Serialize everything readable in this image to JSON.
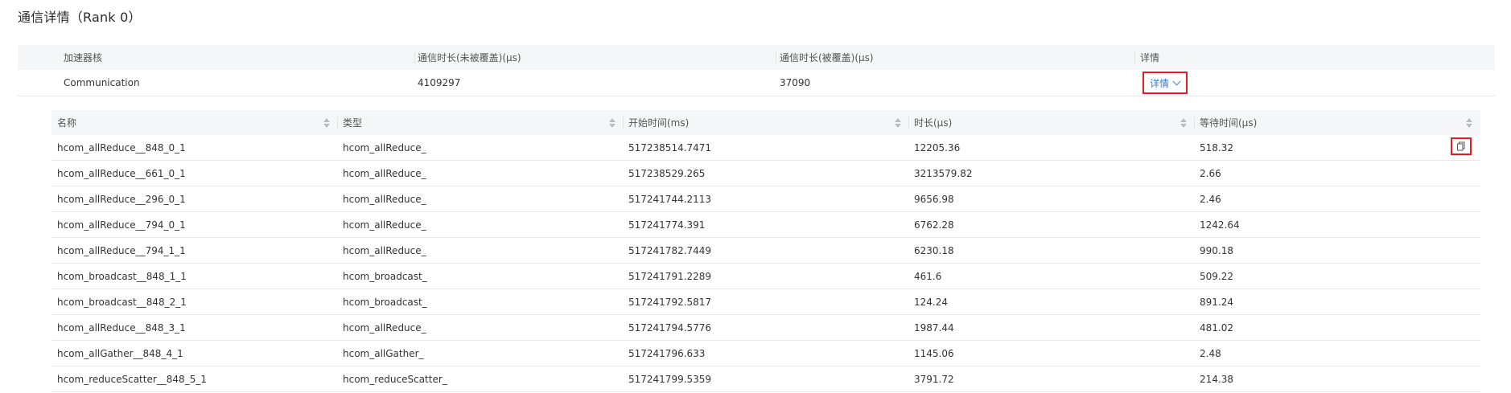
{
  "page_title": "通信详情（Rank 0）",
  "summary": {
    "headers": [
      "加速器核",
      "通信时长(未被覆盖)(μs)",
      "通信时长(被覆盖)(μs)",
      "详情"
    ],
    "row": {
      "core": "Communication",
      "uncovered": "4109297",
      "covered": "37090",
      "detail_label": "详情"
    }
  },
  "detail_table": {
    "headers": [
      "名称",
      "类型",
      "开始时间(ms)",
      "时长(μs)",
      "等待时间(μs)"
    ],
    "rows": [
      [
        "hcom_allReduce__848_0_1",
        "hcom_allReduce_",
        "517238514.7471",
        "12205.36",
        "518.32"
      ],
      [
        "hcom_allReduce__661_0_1",
        "hcom_allReduce_",
        "517238529.265",
        "3213579.82",
        "2.66"
      ],
      [
        "hcom_allReduce__296_0_1",
        "hcom_allReduce_",
        "517241744.2113",
        "9656.98",
        "2.46"
      ],
      [
        "hcom_allReduce__794_0_1",
        "hcom_allReduce_",
        "517241774.391",
        "6762.28",
        "1242.64"
      ],
      [
        "hcom_allReduce__794_1_1",
        "hcom_allReduce_",
        "517241782.7449",
        "6230.18",
        "990.18"
      ],
      [
        "hcom_broadcast__848_1_1",
        "hcom_broadcast_",
        "517241791.2289",
        "461.6",
        "509.22"
      ],
      [
        "hcom_broadcast__848_2_1",
        "hcom_broadcast_",
        "517241792.5817",
        "124.24",
        "891.24"
      ],
      [
        "hcom_allReduce__848_3_1",
        "hcom_allReduce_",
        "517241794.5776",
        "1987.44",
        "481.02"
      ],
      [
        "hcom_allGather__848_4_1",
        "hcom_allGather_",
        "517241796.633",
        "1145.06",
        "2.48"
      ],
      [
        "hcom_reduceScatter__848_5_1",
        "hcom_reduceScatter_",
        "517241799.5359",
        "3791.72",
        "214.38"
      ]
    ]
  },
  "colors": {
    "accent": "#3a7bd5",
    "highlight_border": "#e02020",
    "header_bg": "#f5f6f8"
  }
}
